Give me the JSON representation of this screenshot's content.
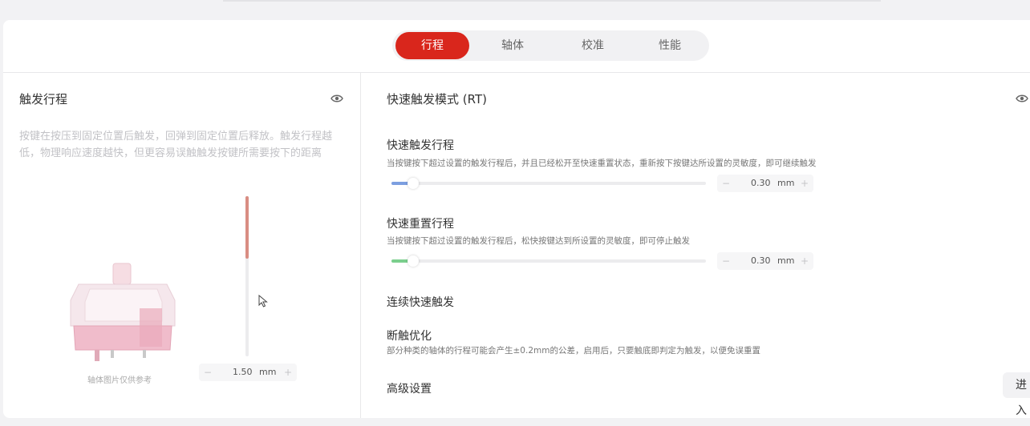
{
  "tabs": [
    "行程",
    "轴体",
    "校准",
    "性能"
  ],
  "left": {
    "title": "触发行程",
    "description": "按键在按压到固定位置后触发，回弹到固定位置后释放。触发行程越低，物理响应速度越快，但更容易误触触发按键所需要按下的距离",
    "image_caption": "轴体图片仅供参考",
    "stepper": {
      "value": "1.50",
      "unit": "mm",
      "minus": "−",
      "plus": "+"
    },
    "level_fraction": 0.39
  },
  "right": {
    "title": "快速触发模式 (RT)",
    "rt_travel": {
      "title": "快速触发行程",
      "desc": "当按键按下超过设置的触发行程后，并且已经松开至快速重置状态，重新按下按键达所设置的灵敏度，即可继续触发",
      "value": "0.30",
      "unit": "mm",
      "minus": "−",
      "plus": "+",
      "fraction": 0.07,
      "color": "#7c9fe0"
    },
    "rt_reset": {
      "title": "快速重置行程",
      "desc": "当按键按下超过设置的触发行程后，松快按键达到所设置的灵敏度，即可停止触发",
      "value": "0.30",
      "unit": "mm",
      "minus": "−",
      "plus": "+",
      "fraction": 0.07,
      "color": "#7bcf8d"
    },
    "continuous": {
      "title": "连续快速触发"
    },
    "break_opt": {
      "title": "断触优化",
      "desc": "部分种类的轴体的行程可能会产生±0.2mm的公差，启用后，只要触底即判定为触发，以便免误重置"
    },
    "advanced": {
      "title": "高级设置",
      "button": "进入"
    }
  },
  "colors": {
    "accent": "#d9261c"
  }
}
